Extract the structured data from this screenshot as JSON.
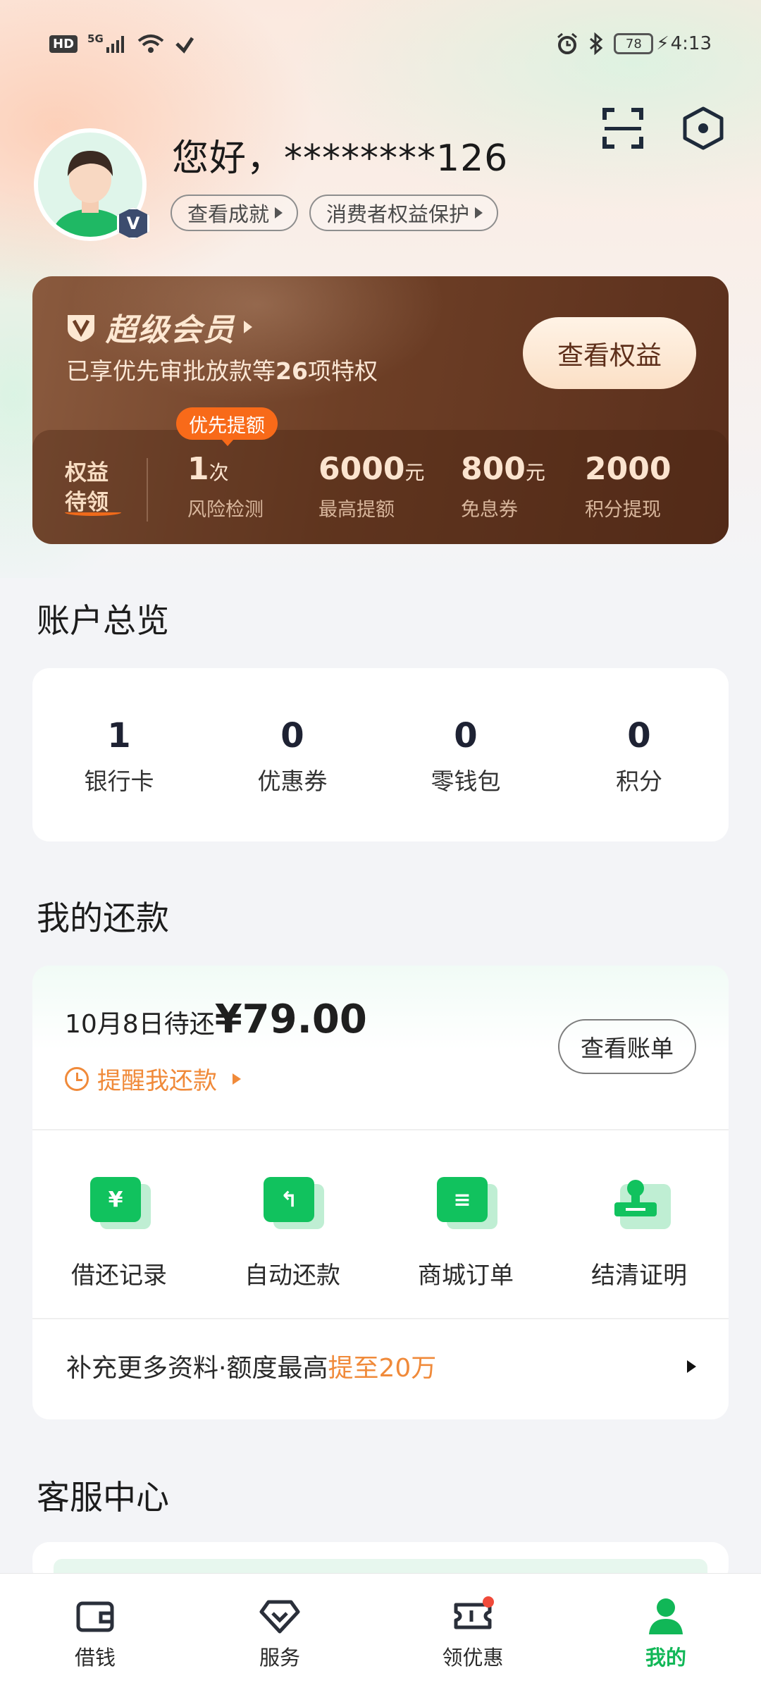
{
  "status_bar": {
    "hd": "HD",
    "network": "5G",
    "battery": "78",
    "time": "4:13"
  },
  "header": {
    "greeting": "您好，********126",
    "chips": [
      "查看成就",
      "消费者权益保护"
    ],
    "avatar_badge": "V",
    "icons": [
      "scan-icon",
      "settings-hex-icon"
    ]
  },
  "member": {
    "title": "超级会员",
    "subtitle_prefix": "已享优先审批放款等",
    "subtitle_count": "26",
    "subtitle_suffix": "项特权",
    "button": "查看权益",
    "pending": [
      "权益",
      "待领"
    ],
    "tag": "优先提额",
    "benefits": [
      {
        "value": "1",
        "unit": "次",
        "label": "风险检测"
      },
      {
        "value": "6000",
        "unit": "元",
        "label": "最高提额"
      },
      {
        "value": "800",
        "unit": "元",
        "label": "免息券"
      },
      {
        "value": "2000",
        "unit": "",
        "label": "积分提现"
      }
    ]
  },
  "overview": {
    "title": "账户总览",
    "items": [
      {
        "num": "1",
        "label": "银行卡"
      },
      {
        "num": "0",
        "label": "优惠券"
      },
      {
        "num": "0",
        "label": "零钱包"
      },
      {
        "num": "0",
        "label": "积分"
      }
    ]
  },
  "repay": {
    "title": "我的还款",
    "due_text": "10月8日待还",
    "amount": "¥79.00",
    "remind": "提醒我还款",
    "bill_button": "查看账单",
    "quick": [
      {
        "glyph": "¥",
        "label": "借还记录"
      },
      {
        "glyph": "↰",
        "label": "自动还款"
      },
      {
        "glyph": "≡",
        "label": "商城订单"
      },
      {
        "glyph": "",
        "label": "结清证明"
      }
    ],
    "more_prefix": "补充更多资料·额度最高",
    "more_highlight": "提至20万"
  },
  "service": {
    "title": "客服中心"
  },
  "tabbar": {
    "tabs": [
      {
        "label": "借钱",
        "icon": "wallet-icon"
      },
      {
        "label": "服务",
        "icon": "diamond-icon"
      },
      {
        "label": "领优惠",
        "icon": "ticket-icon"
      },
      {
        "label": "我的",
        "icon": "user-icon"
      }
    ],
    "active": 3
  },
  "colors": {
    "accent_green": "#11c25e",
    "accent_orange": "#f08a3a",
    "member_brown": "#6e3f26"
  }
}
